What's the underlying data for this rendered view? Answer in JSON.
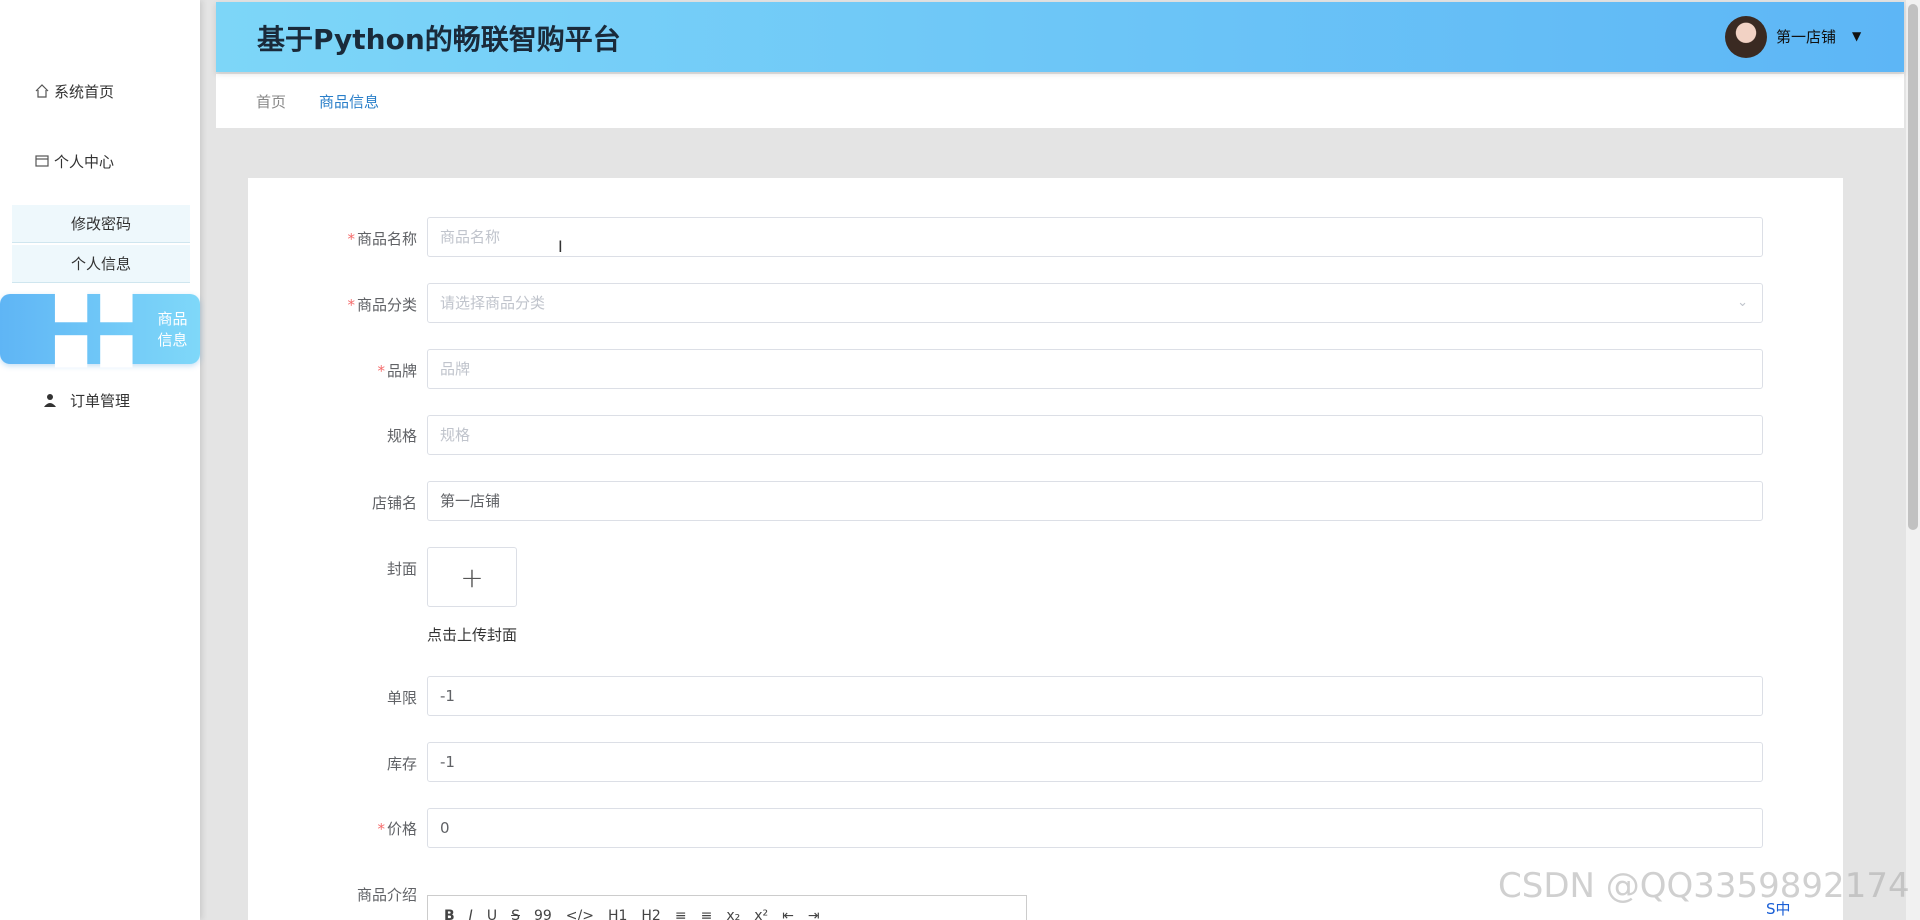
{
  "sidebar": {
    "home": "系统首页",
    "center": "个人中心",
    "sub1": "修改密码",
    "sub2": "个人信息",
    "active": "商品信息",
    "order": "订单管理"
  },
  "header": {
    "title": "基于Python的畅联智购平台",
    "shop": "第一店铺"
  },
  "breadcrumb": {
    "home": "首页",
    "current": "商品信息"
  },
  "form": {
    "name": {
      "label": "商品名称",
      "placeholder": "商品名称"
    },
    "category": {
      "label": "商品分类",
      "placeholder": "请选择商品分类"
    },
    "brand": {
      "label": "品牌",
      "placeholder": "品牌"
    },
    "spec": {
      "label": "规格",
      "placeholder": "规格"
    },
    "store": {
      "label": "店铺名",
      "value": "第一店铺"
    },
    "cover": {
      "label": "封面",
      "tip": "点击上传封面"
    },
    "limit": {
      "label": "单限",
      "value": "-1"
    },
    "stock": {
      "label": "库存",
      "value": "-1"
    },
    "price": {
      "label": "价格",
      "value": "0"
    },
    "intro": {
      "label": "商品介绍"
    }
  },
  "editor_tools": [
    "B",
    "I",
    "U",
    "S",
    "99",
    "</>",
    "H1",
    "H2",
    "≡",
    "≡",
    "x₂",
    "x²",
    "⇤",
    "⇥"
  ],
  "watermark": "CSDN @QQ3359892174",
  "ime": "S中",
  "colors": {
    "accent": "#5db6f6",
    "required": "#f56c6c",
    "link": "#2a7fc9"
  }
}
